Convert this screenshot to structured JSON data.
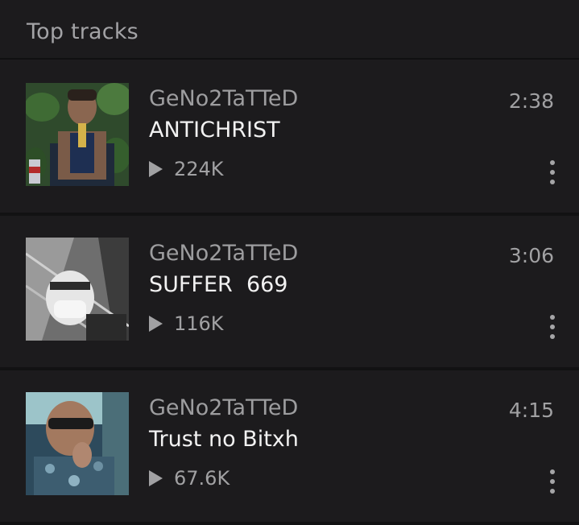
{
  "header": {
    "title": "Top tracks"
  },
  "tracks": [
    {
      "artist": "GeNo2TaTTeD",
      "title": "ANTICHRIST",
      "duration": "2:38",
      "plays": "224K"
    },
    {
      "artist": "GeNo2TaTTeD",
      "title": "SUFFER  669",
      "duration": "3:06",
      "plays": "116K"
    },
    {
      "artist": "GeNo2TaTTeD",
      "title": "Trust no Bitxh",
      "duration": "4:15",
      "plays": "67.6K"
    }
  ]
}
